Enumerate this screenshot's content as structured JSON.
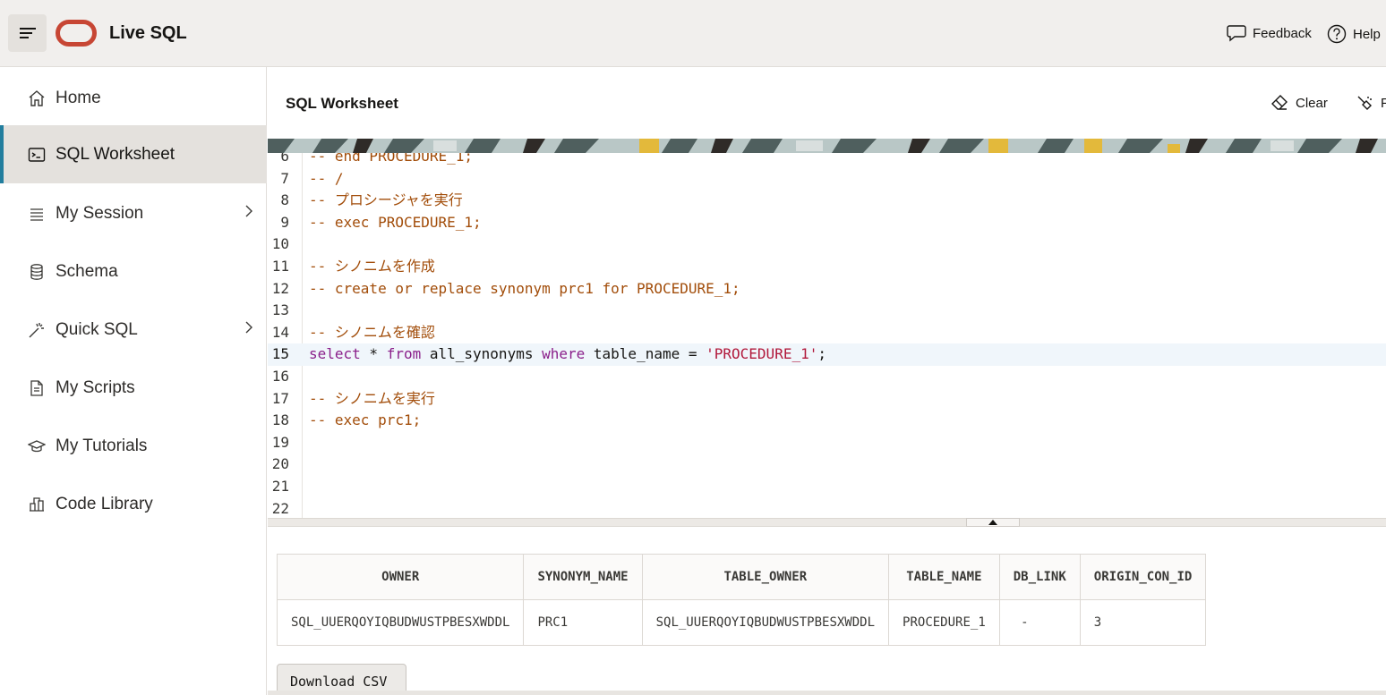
{
  "header": {
    "app_title": "Live SQL",
    "feedback_label": "Feedback",
    "help_label": "Help"
  },
  "sidebar": {
    "items": [
      {
        "label": "Home",
        "icon": "home-icon"
      },
      {
        "label": "SQL Worksheet",
        "icon": "terminal-icon",
        "active": true
      },
      {
        "label": "My Session",
        "icon": "list-icon",
        "has_submenu": true
      },
      {
        "label": "Schema",
        "icon": "database-icon"
      },
      {
        "label": "Quick SQL",
        "icon": "magic-wand-icon",
        "has_submenu": true
      },
      {
        "label": "My Scripts",
        "icon": "document-icon"
      },
      {
        "label": "My Tutorials",
        "icon": "graduation-cap-icon"
      },
      {
        "label": "Code Library",
        "icon": "library-icon"
      }
    ]
  },
  "worksheet": {
    "title": "SQL Worksheet",
    "clear_label": "Clear",
    "format_label": "F"
  },
  "editor": {
    "current_line": 15,
    "lines": [
      {
        "n": "6",
        "text": "-- end PROCEDURE_1;"
      },
      {
        "n": "7",
        "text": "-- /"
      },
      {
        "n": "8",
        "text": "-- プロシージャを実行"
      },
      {
        "n": "9",
        "text": "-- exec PROCEDURE_1;"
      },
      {
        "n": "10",
        "text": ""
      },
      {
        "n": "11",
        "text": "-- シノニムを作成"
      },
      {
        "n": "12",
        "text": "-- create or replace synonym prc1 for PROCEDURE_1;"
      },
      {
        "n": "13",
        "text": ""
      },
      {
        "n": "14",
        "text": "-- シノニムを確認"
      },
      {
        "n": "15",
        "kw1": "select",
        "op": " * ",
        "kw2": "from",
        "p1": " all_synonyms ",
        "kw3": "where",
        "p2": " table_name = ",
        "str": "'PROCEDURE_1'",
        "end": ";"
      },
      {
        "n": "16",
        "text": ""
      },
      {
        "n": "17",
        "text": "-- シノニムを実行"
      },
      {
        "n": "18",
        "text": "-- exec prc1;"
      },
      {
        "n": "19",
        "text": ""
      },
      {
        "n": "20",
        "text": ""
      },
      {
        "n": "21",
        "text": ""
      },
      {
        "n": "22",
        "text": ""
      }
    ]
  },
  "results": {
    "columns": [
      "OWNER",
      "SYNONYM_NAME",
      "TABLE_OWNER",
      "TABLE_NAME",
      "DB_LINK",
      "ORIGIN_CON_ID"
    ],
    "rows": [
      [
        "SQL_UUERQOYIQBUDWUSTPBESXWDDL",
        "PRC1",
        "SQL_UUERQOYIQBUDWUSTPBESXWDDL",
        "PROCEDURE_1",
        " -",
        "3"
      ]
    ],
    "download_label": "Download CSV"
  },
  "colors": {
    "accent": "#227e9e",
    "oracle_red": "#c74634",
    "comment": "#a24d0a",
    "keyword": "#8a1f8a",
    "string": "#b1183b"
  }
}
